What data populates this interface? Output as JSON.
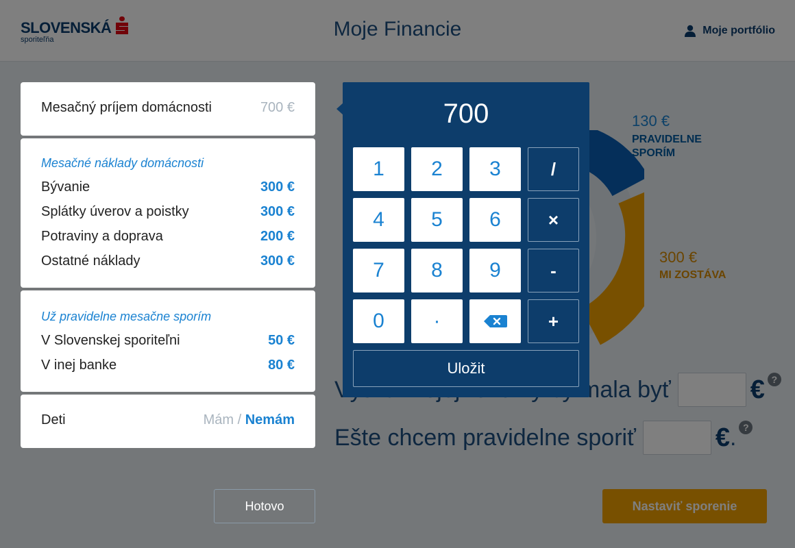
{
  "header": {
    "logo_main": "SLOVENSKÁ",
    "logo_sub": "sporiteľňa",
    "title": "Moje Financie",
    "portfolio_label": "Moje portfólio"
  },
  "income": {
    "label": "Mesačný príjem domácnosti",
    "value": "700 €"
  },
  "costs": {
    "title": "Mesačné náklady domácnosti",
    "items": [
      {
        "label": "Bývanie",
        "value": "300 €"
      },
      {
        "label": "Splátky úverov a poistky",
        "value": "300 €"
      },
      {
        "label": "Potraviny a doprava",
        "value": "200 €"
      },
      {
        "label": "Ostatné náklady",
        "value": "300 €"
      }
    ]
  },
  "savings": {
    "title": "Už pravidelne mesačne sporím",
    "items": [
      {
        "label": "V Slovenskej sporiteľni",
        "value": "50 €"
      },
      {
        "label": "V inej banke",
        "value": "80 €"
      }
    ]
  },
  "kids": {
    "label": "Deti",
    "option_have": "Mám",
    "separator": " / ",
    "option_have_not": "Nemám"
  },
  "chart": {
    "saving_value": "130 €",
    "saving_caption_1": "PRAVIDELNE",
    "saving_caption_2": "SPORÍM",
    "remaining_value": "300 €",
    "remaining_caption": "MI ZOSTÁVA",
    "colors": {
      "saving": "#0a5fb4",
      "remaining": "#f0a100",
      "track": "#dfe6ec"
    }
  },
  "goals": {
    "reserve_label": "Výška mojej rezervy by mala byť",
    "save_label": "Ešte chcem pravidelne sporiť",
    "currency": "€",
    "period": ".",
    "help": "?"
  },
  "buttons": {
    "done": "Hotovo",
    "setup": "Nastaviť sporenie"
  },
  "keypad": {
    "display": "700",
    "digits": [
      "1",
      "2",
      "3",
      "4",
      "5",
      "6",
      "7",
      "8",
      "9",
      "0",
      "·"
    ],
    "ops": [
      "/",
      "×",
      "-",
      "+"
    ],
    "save": "Uložit"
  }
}
